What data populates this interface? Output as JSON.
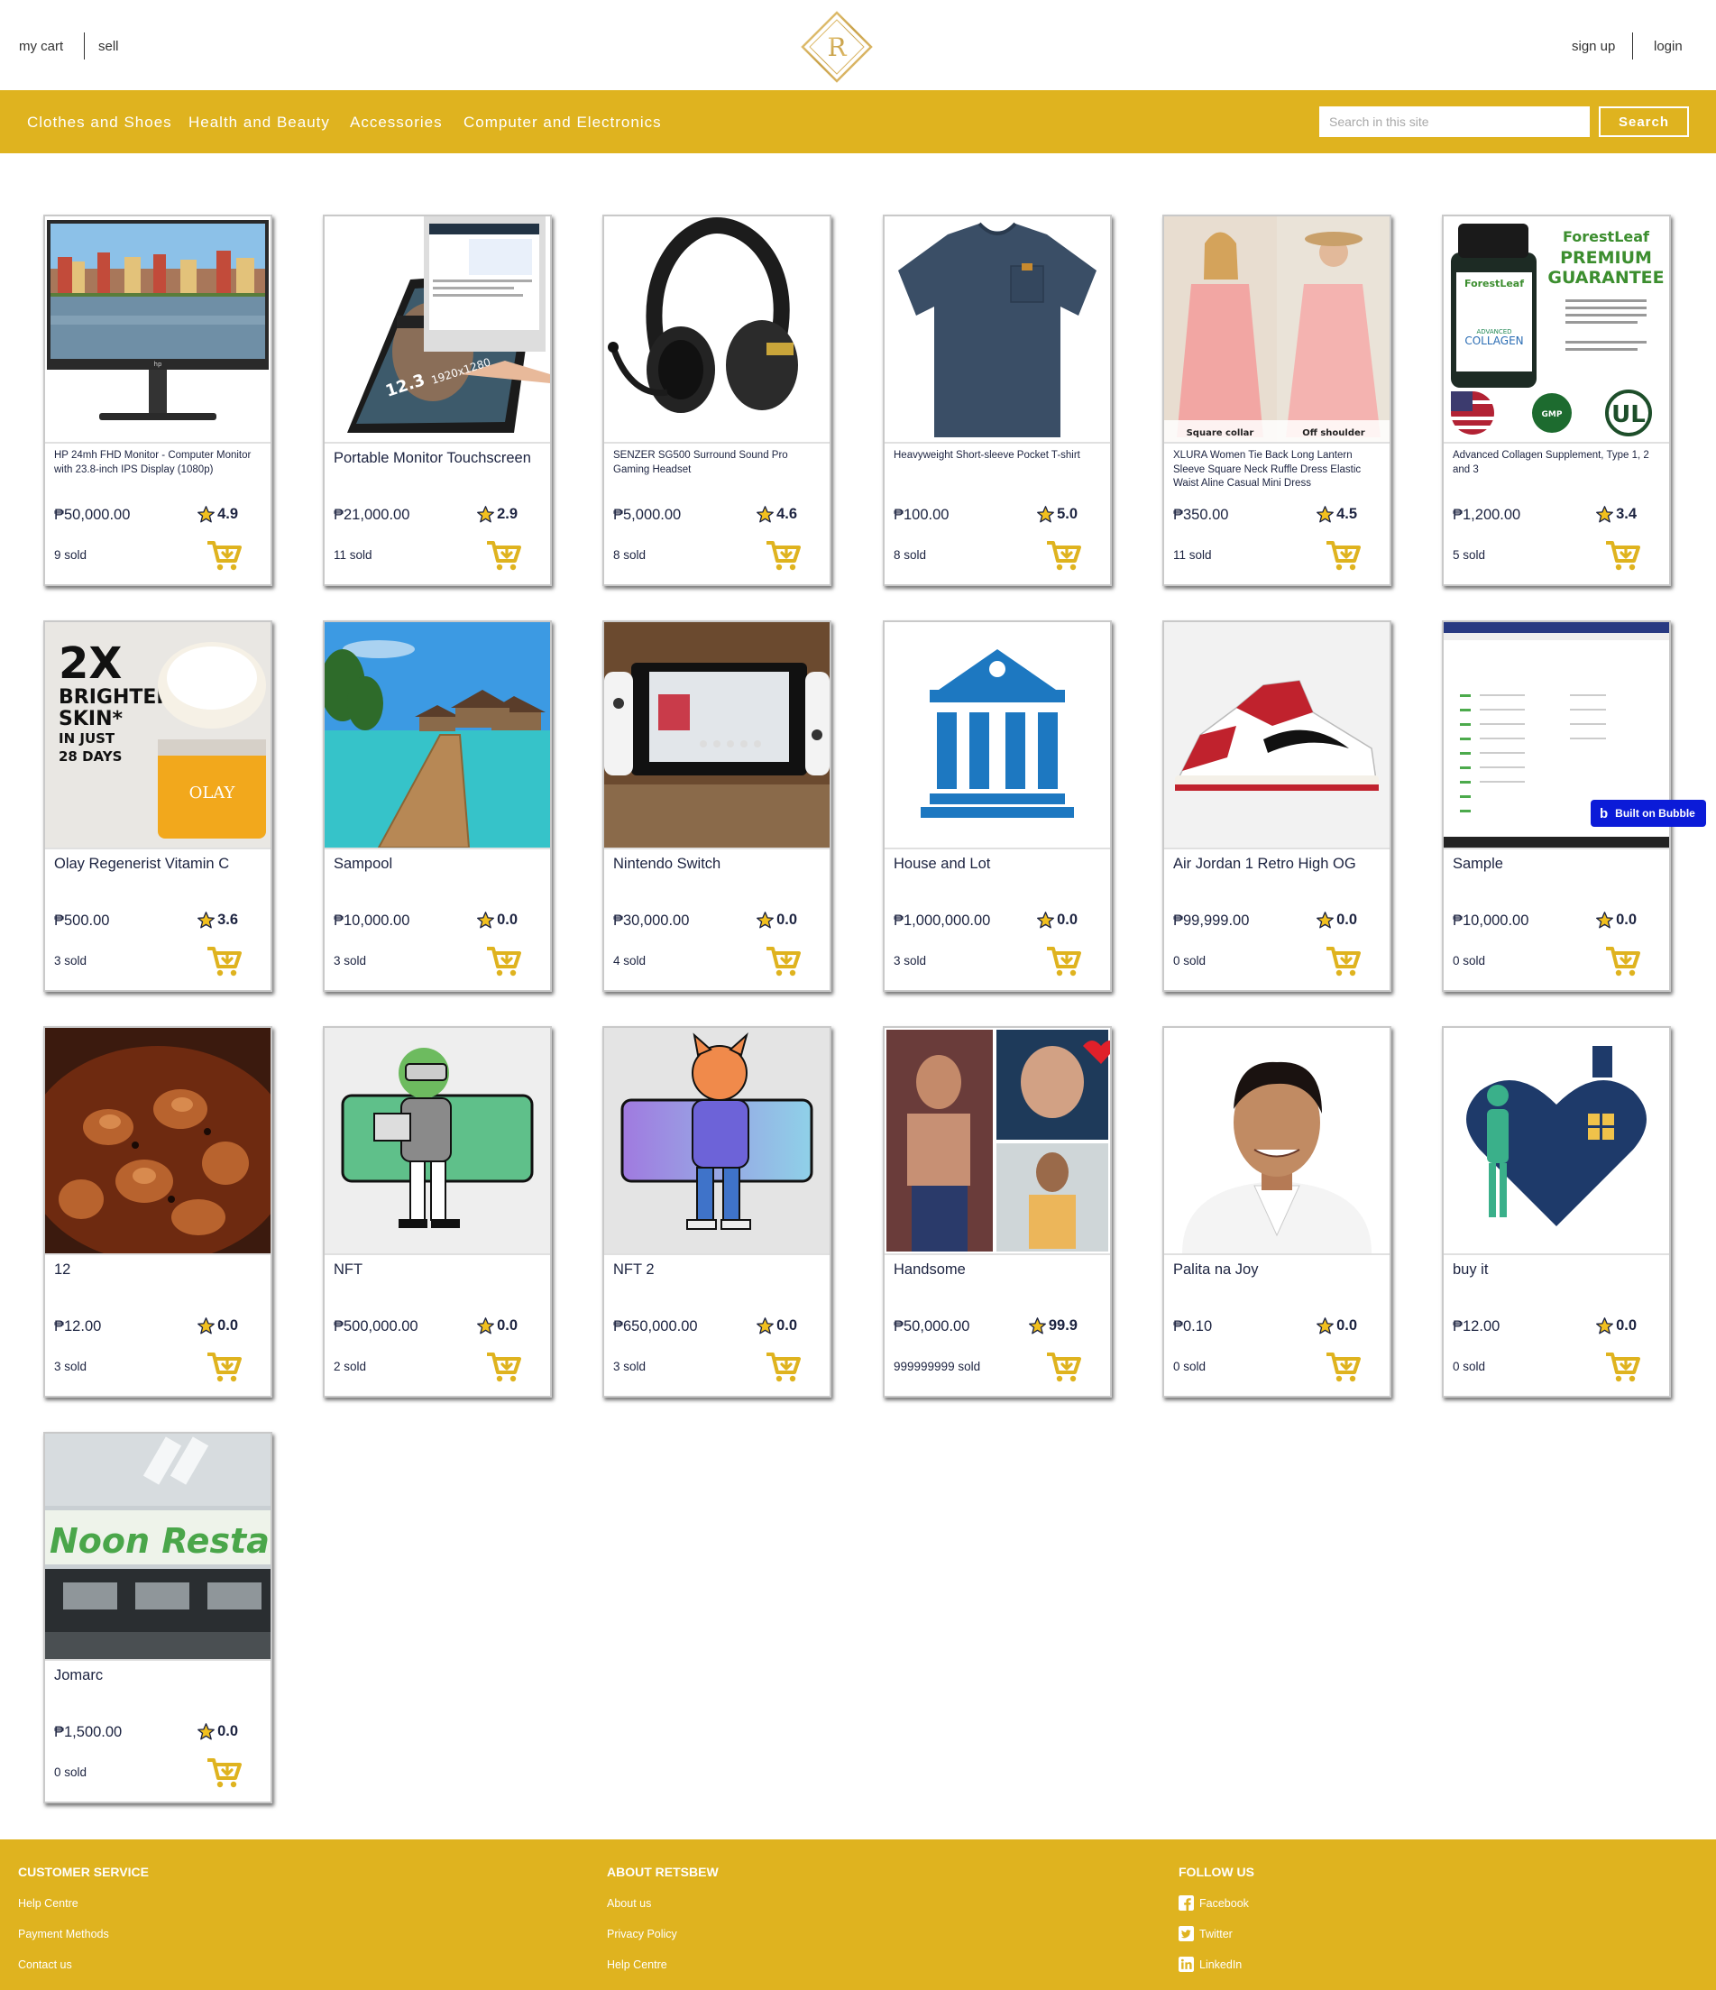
{
  "header": {
    "my_cart": "my cart",
    "sell": "sell",
    "sign_up": "sign up",
    "login": "login",
    "logo_letter": "R"
  },
  "nav": {
    "categories": [
      "Clothes and Shoes",
      "Health and Beauty",
      "Accessories",
      "Computer and Electronics"
    ],
    "search_placeholder": "Search in this site",
    "search_button": "Search"
  },
  "colors": {
    "accent": "#dfb31f",
    "text": "#1c2340",
    "badge": "#0b1bd8"
  },
  "products": [
    {
      "name": "HP 24mh FHD Monitor - Computer Monitor with 23.8-inch IPS Display (1080p)",
      "price": "₱50,000.00",
      "rating": "4.9",
      "sold": "9 sold",
      "image": "monitor"
    },
    {
      "name": "Portable Monitor Touchscreen",
      "price": "₱21,000.00",
      "rating": "2.9",
      "sold": "11 sold",
      "image": "portable-monitor"
    },
    {
      "name": "SENZER SG500 Surround Sound Pro Gaming Headset",
      "price": "₱5,000.00",
      "rating": "4.6",
      "sold": "8 sold",
      "image": "headset"
    },
    {
      "name": "Heavyweight Short-sleeve Pocket T-shirt",
      "price": "₱100.00",
      "rating": "5.0",
      "sold": "8 sold",
      "image": "tshirt"
    },
    {
      "name": "XLURA Women Tie Back Long Lantern Sleeve Square Neck Ruffle Dress Elastic Waist Aline Casual Mini Dress",
      "price": "₱350.00",
      "rating": "4.5",
      "sold": "11 sold",
      "image": "dress",
      "image_labels": [
        "Square collar",
        "Off shoulder"
      ]
    },
    {
      "name": "Advanced Collagen Supplement, Type 1, 2 and 3",
      "price": "₱1,200.00",
      "rating": "3.4",
      "sold": "5 sold",
      "image": "collagen",
      "image_text": [
        "ForestLeaf",
        "PREMIUM",
        "GUARANTEE",
        "ADVANCED",
        "COLLAGEN",
        "GMP",
        "UL"
      ]
    },
    {
      "name": "Olay Regenerist Vitamin C",
      "price": "₱500.00",
      "rating": "3.6",
      "sold": "3 sold",
      "image": "olay",
      "image_text": [
        "2X",
        "BRIGHTER",
        "SKIN*",
        "IN JUST",
        "28 DAYS",
        "OLAY"
      ]
    },
    {
      "name": "Sampool",
      "price": "₱10,000.00",
      "rating": "0.0",
      "sold": "3 sold",
      "image": "resort"
    },
    {
      "name": "Nintendo Switch",
      "price": "₱30,000.00",
      "rating": "0.0",
      "sold": "4 sold",
      "image": "switch"
    },
    {
      "name": "House and Lot",
      "price": "₱1,000,000.00",
      "rating": "0.0",
      "sold": "3 sold",
      "image": "bank"
    },
    {
      "name": "Air Jordan 1 Retro High OG",
      "price": "₱99,999.00",
      "rating": "0.0",
      "sold": "0 sold",
      "image": "sneaker"
    },
    {
      "name": "Sample",
      "price": "₱10,000.00",
      "rating": "0.0",
      "sold": "0 sold",
      "image": "screenshot"
    },
    {
      "name": "12",
      "price": "₱12.00",
      "rating": "0.0",
      "sold": "3 sold",
      "image": "food"
    },
    {
      "name": "NFT",
      "price": "₱500,000.00",
      "rating": "0.0",
      "sold": "2 sold",
      "image": "nft-green"
    },
    {
      "name": "NFT 2",
      "price": "₱650,000.00",
      "rating": "0.0",
      "sold": "3 sold",
      "image": "nft-fox"
    },
    {
      "name": "Handsome",
      "price": "₱50,000.00",
      "rating": "99.9",
      "sold": "999999999 sold",
      "image": "collage"
    },
    {
      "name": "Palita na Joy",
      "price": "₱0.10",
      "rating": "0.0",
      "sold": "0 sold",
      "image": "portrait"
    },
    {
      "name": "buy it",
      "price": "₱12.00",
      "rating": "0.0",
      "sold": "0 sold",
      "image": "care-logo"
    },
    {
      "name": "Jomarc",
      "price": "₱1,500.00",
      "rating": "0.0",
      "sold": "0 sold",
      "image": "restaurant",
      "image_text": "Noon Restau"
    }
  ],
  "badge": {
    "icon": "b",
    "label": "Built on Bubble"
  },
  "footer": {
    "customer_service": {
      "heading": "CUSTOMER SERVICE",
      "links": [
        "Help Centre",
        "Payment Methods",
        "Contact us"
      ]
    },
    "about": {
      "heading": "ABOUT RETSBEW",
      "links": [
        "About us",
        "Privacy Policy",
        "Help Centre"
      ]
    },
    "follow": {
      "heading": "FOLLOW US",
      "links": [
        {
          "label": "Facebook",
          "icon": "facebook-icon"
        },
        {
          "label": "Twitter",
          "icon": "twitter-icon"
        },
        {
          "label": "LinkedIn",
          "icon": "linkedin-icon"
        }
      ]
    }
  }
}
